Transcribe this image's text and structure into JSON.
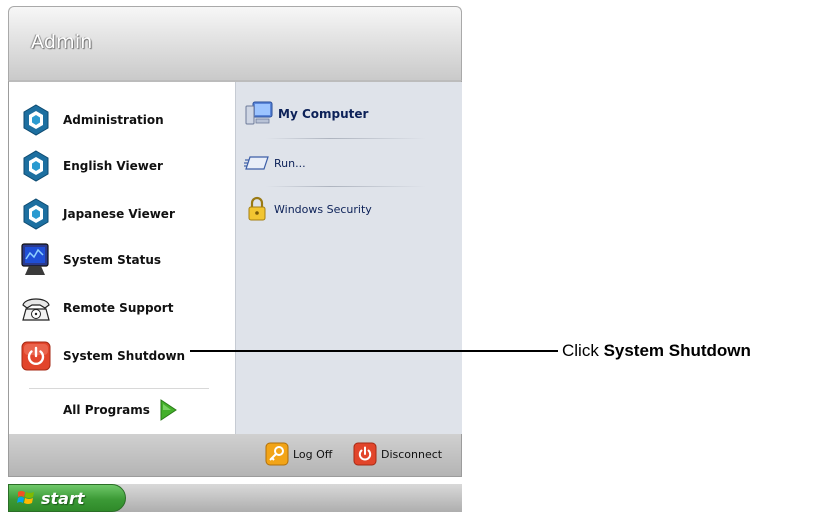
{
  "header": {
    "user_name": "Admin"
  },
  "left_items": [
    {
      "label": "Administration",
      "icon": "hexagon-app-icon"
    },
    {
      "label": "English Viewer",
      "icon": "hexagon-app-icon"
    },
    {
      "label": "Japanese Viewer",
      "icon": "hexagon-app-icon"
    },
    {
      "label": "System Status",
      "icon": "monitor-icon"
    },
    {
      "label": "Remote Support",
      "icon": "telephone-icon"
    },
    {
      "label": "System Shutdown",
      "icon": "power-icon"
    }
  ],
  "all_programs": {
    "label": "All Programs",
    "icon": "green-arrow-icon"
  },
  "right_items": [
    {
      "label": "My Computer",
      "icon": "computer-icon"
    },
    {
      "label": "Run...",
      "icon": "run-icon"
    },
    {
      "label": "Windows Security",
      "icon": "padlock-icon"
    }
  ],
  "footer": {
    "log_off": "Log Off",
    "disconnect": "Disconnect"
  },
  "taskbar": {
    "start_label": "start"
  },
  "callout": {
    "prefix": "Click ",
    "target": "System Shutdown"
  },
  "colors": {
    "accent_green": "#3c9a36",
    "power_red": "#e2452b",
    "right_pane": "#dfe3ea"
  }
}
